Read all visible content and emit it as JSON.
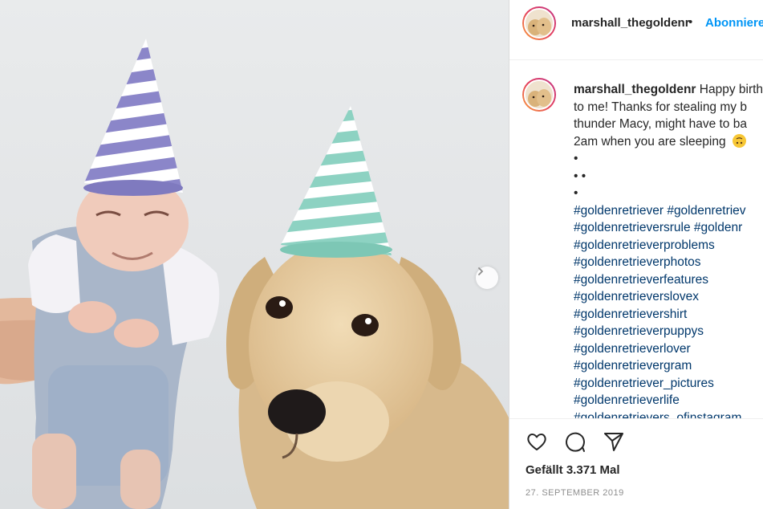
{
  "header": {
    "username": "marshall_thegoldenr",
    "dot": "•",
    "follow_label": "Abonnieren"
  },
  "caption": {
    "username": "marshall_thegoldenr",
    "line1_text": "Happy birthday",
    "line2": "to me! Thanks for stealing my b",
    "line3": "thunder Macy, might have to ba",
    "line4": "2am when you are sleeping",
    "dots": [
      "•",
      "• •",
      "•"
    ]
  },
  "hashtags": [
    "#goldenretriever #goldenretriev",
    "#goldenretrieversrule #goldenr",
    "#goldenretrieverproblems",
    "#goldenretrieverphotos",
    "#goldenretrieverfeatures",
    "#goldenretrieverslovex",
    "#goldenretrievershirt",
    "#goldenretrieverpuppys",
    "#goldenretrieverlover",
    "#goldenretrievergram",
    "#goldenretriever_pictures",
    "#goldenretrieverlife",
    "#goldenretrievers_ofinstagram"
  ],
  "actions": {
    "like_icon": "heart-icon",
    "comment_icon": "comment-icon",
    "share_icon": "paper-plane-icon"
  },
  "likes_text": "Gefällt 3.371 Mal",
  "date_text": "27. SEPTEMBER 2019",
  "colors": {
    "link": "#00376b",
    "follow": "#0095f6",
    "text": "#262626",
    "muted": "#8e8e8e",
    "hat_baby": "#8b86c9",
    "hat_dog": "#8dd2c2",
    "dog_fur": "#e2c79a"
  }
}
